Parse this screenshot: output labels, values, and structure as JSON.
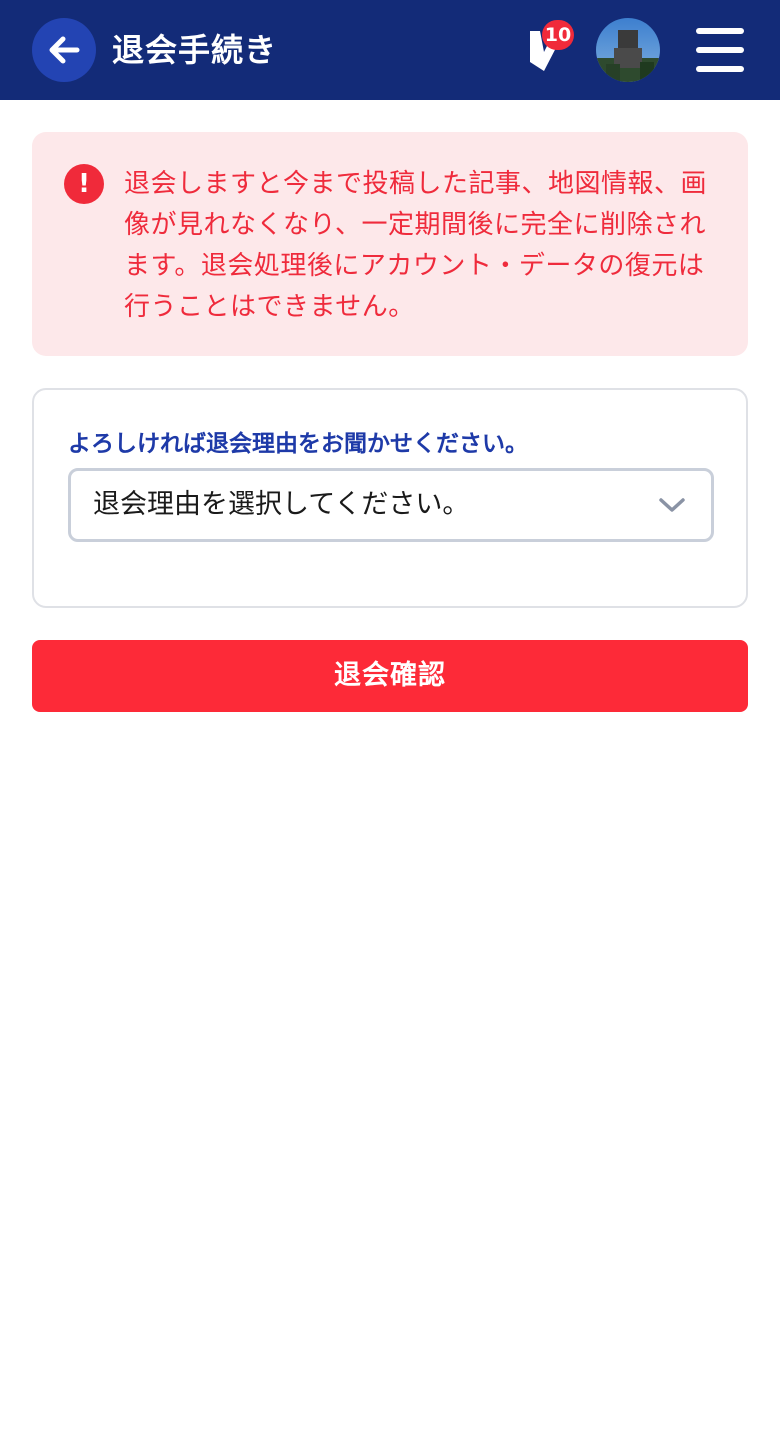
{
  "header": {
    "back_icon": "arrow-left-icon",
    "title": "退会手続き",
    "notification_icon": "bookmark-v-icon",
    "notification_count": "10",
    "avatar_icon": "user-avatar",
    "menu_icon": "hamburger-menu-icon"
  },
  "warning": {
    "icon": "exclamation-circle-icon",
    "message": "退会しますと今まで投稿した記事、地図情報、画像が見れなくなり、一定期間後に完全に削除されます。退会処理後にアカウント・データの復元は行うことはできません。"
  },
  "reason_form": {
    "label": "よろしければ退会理由をお聞かせください。",
    "select_value": "退会理由を選択してください。",
    "select_icon": "chevron-down-icon"
  },
  "actions": {
    "confirm_label": "退会確認"
  },
  "colors": {
    "header_bg": "#132b78",
    "accent_red": "#fd2a38",
    "warning_bg": "#fde8ea",
    "label_blue": "#1e3aa8"
  }
}
